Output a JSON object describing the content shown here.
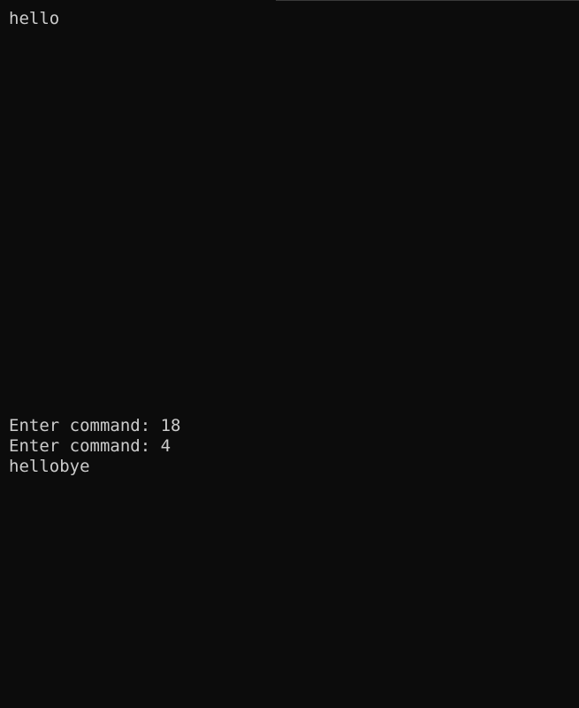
{
  "terminal": {
    "lines": [
      "hello",
      "Enter command: 18",
      "Enter command: 4",
      "hellobye"
    ]
  }
}
